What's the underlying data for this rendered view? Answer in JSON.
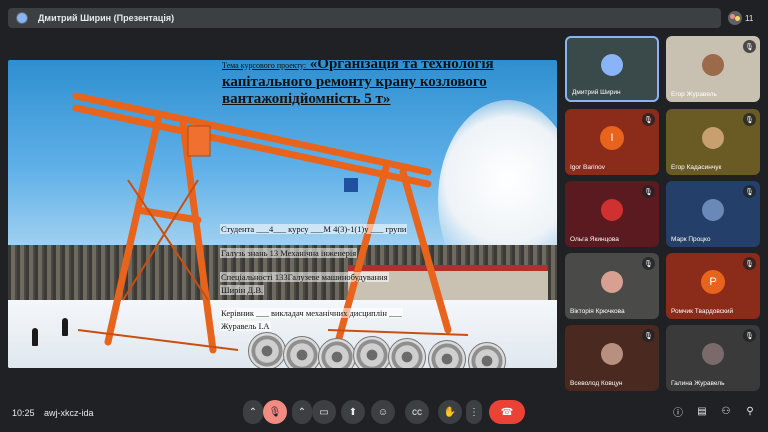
{
  "header": {
    "title": "Дмитрий Ширин (Презентація)",
    "participants_count": "11"
  },
  "slide": {
    "title_prefix": "Тема курсового проекту:",
    "title": "«Організація та технологія капітального ремонту крану козлового вантажопідйомність 5 т»",
    "lines": [
      "Студента ___4___ курсу ___М 4(3)-1(1)у ___ групи",
      "Галузь знань 13 Механічна інженерія",
      "Спеціальності 133Галузеве машинобудування",
      "Ширін Д.В.",
      "Керівник ___ викладач механічних дисциплін ___",
      "Журавель І.А"
    ]
  },
  "participants": [
    {
      "name": "Дмитрий Ширин",
      "mic": "",
      "bg": "#3a4a4a",
      "kind": "face",
      "color": "#8ab4f8"
    },
    {
      "name": "Егор Журавель",
      "mic": "mic-off-icon",
      "bg": "#c8c0b0",
      "kind": "face",
      "color": "#9a6a4a"
    },
    {
      "name": "Igor Barinov",
      "mic": "mic-off-icon",
      "bg": "#8b2b1a",
      "kind": "letter",
      "letter": "I",
      "color": "#e8641c"
    },
    {
      "name": "Егор Кадасинчук",
      "mic": "mic-off-icon",
      "bg": "#6a5a24",
      "kind": "face",
      "color": "#c8a070"
    },
    {
      "name": "Ольга Якинцова",
      "mic": "mic-off-icon",
      "bg": "#5a1a20",
      "kind": "face",
      "color": "#d03030"
    },
    {
      "name": "Марк Процко",
      "mic": "mic-off-icon",
      "bg": "#24406a",
      "kind": "face",
      "color": "#6a88b8"
    },
    {
      "name": "Вікторія Крючкова",
      "mic": "mic-off-icon",
      "bg": "#4a4a48",
      "kind": "face",
      "color": "#d8a090"
    },
    {
      "name": "Ромчик Твардовский",
      "mic": "mic-off-icon",
      "bg": "#8b2b1a",
      "kind": "letter",
      "letter": "P",
      "color": "#e8641c"
    },
    {
      "name": "Всеволод Ковцун",
      "mic": "mic-off-icon",
      "bg": "#4a2a20",
      "kind": "face",
      "color": "#b89080"
    },
    {
      "name": "Галина Журавель",
      "mic": "mic-off-icon",
      "bg": "#3a3a3a",
      "kind": "face",
      "color": "#7a6a6a"
    }
  ],
  "bottom": {
    "time": "10:25",
    "meeting_code": "awj-xkcz-ida"
  },
  "controls": [
    "chevron-up-icon",
    "mic-off-icon",
    "chevron-up-icon",
    "camera-icon",
    "present-icon",
    "emoji-icon",
    "captions-icon",
    "raise-hand-icon",
    "more-options-icon",
    "end-call-icon"
  ],
  "right_controls": [
    "info-icon",
    "chat-icon",
    "people-icon",
    "activities-icon"
  ],
  "colors": {
    "end_call": "#ea4335",
    "mic_off": "#f28b82",
    "crane": "#e8641c"
  }
}
